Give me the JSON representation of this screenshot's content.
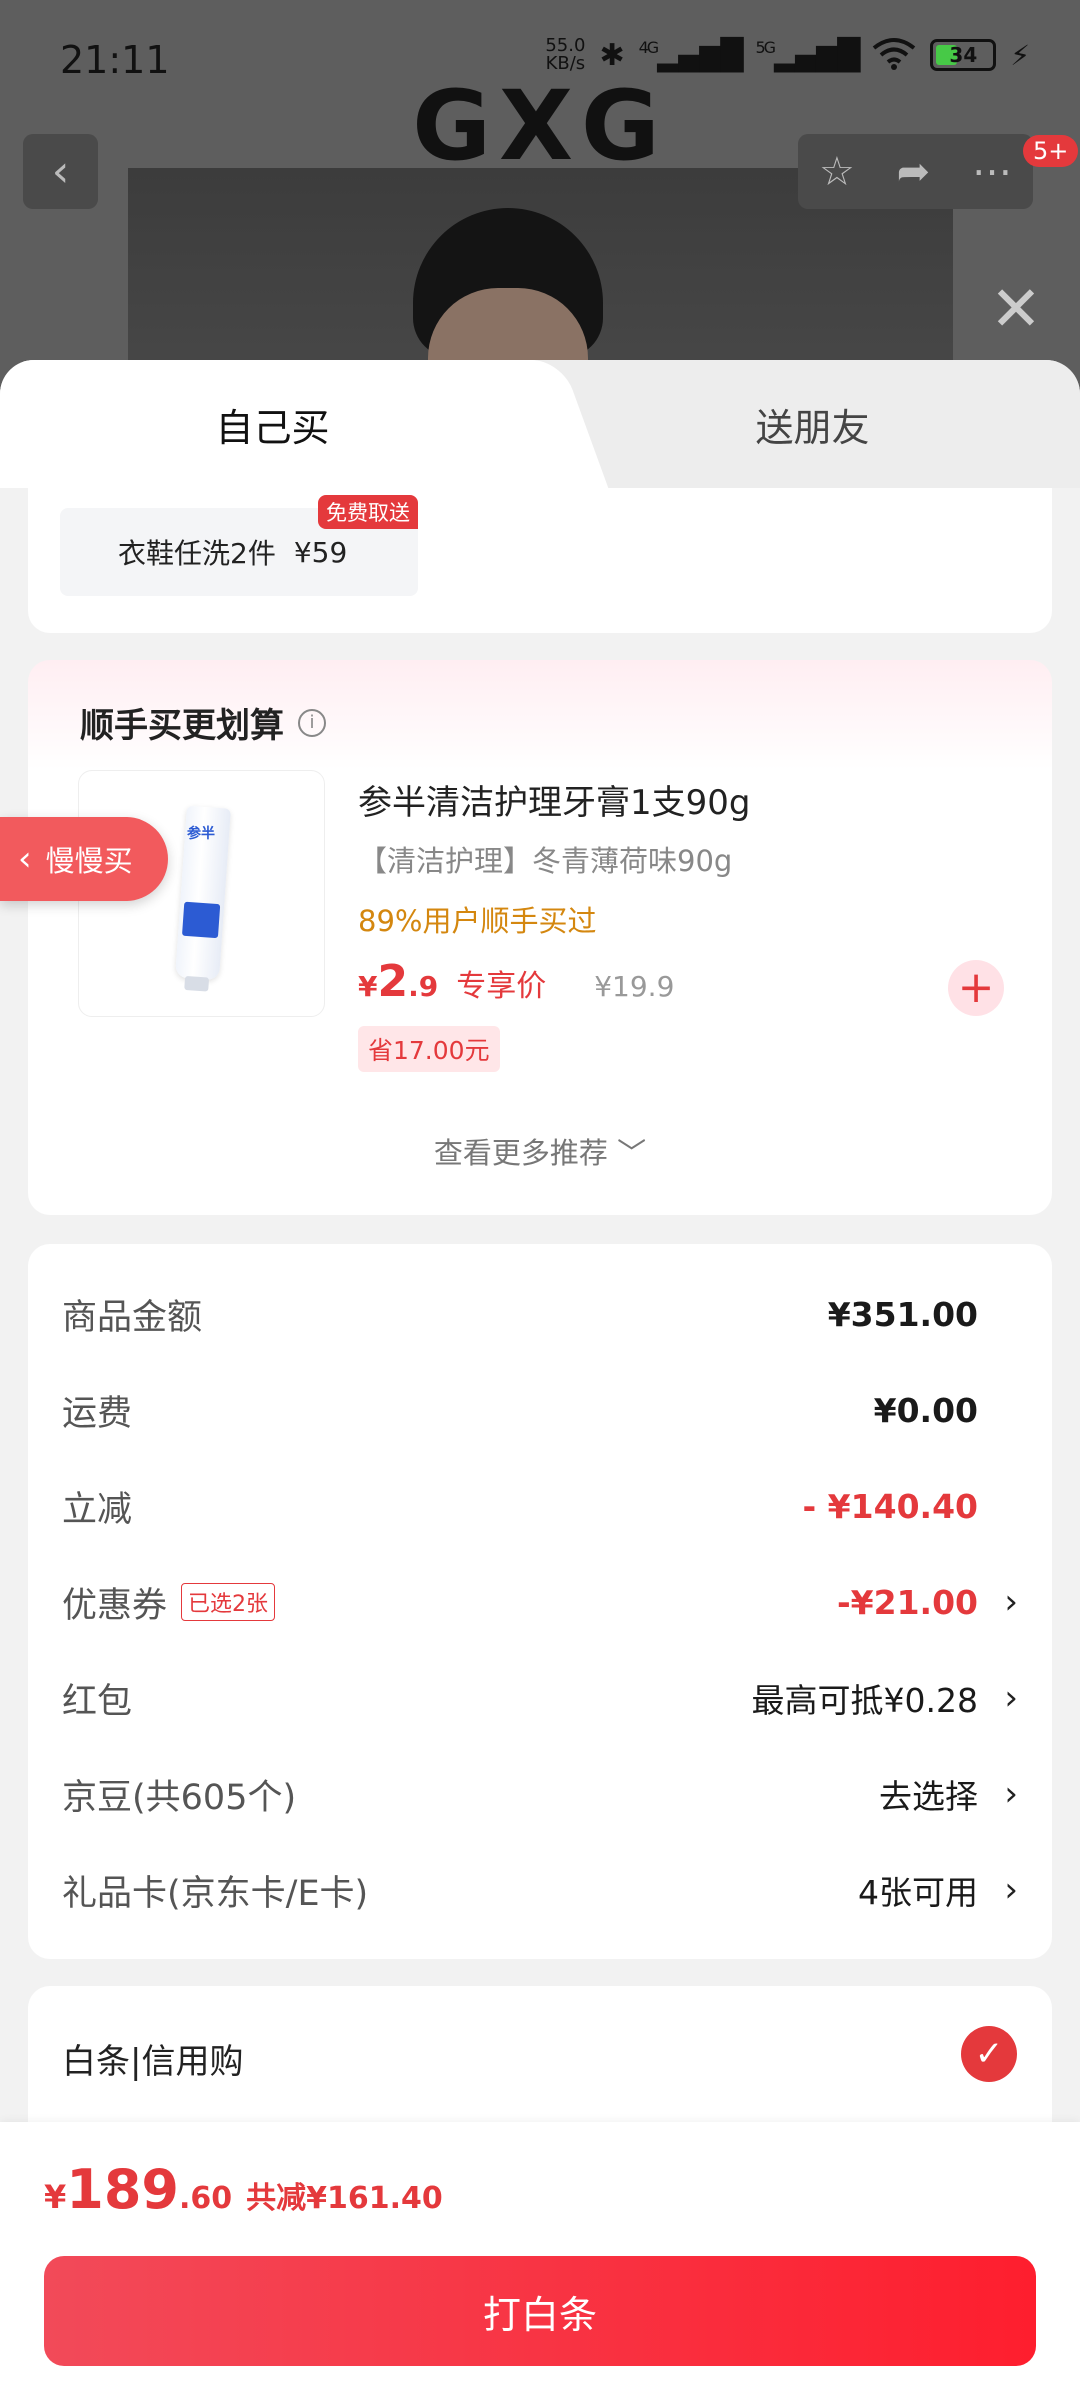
{
  "status_bar": {
    "time": "21:11",
    "net_speed_value": "55.0",
    "net_speed_unit": "KB/s",
    "signal_1": "4G",
    "signal_2": "5G",
    "battery": "34"
  },
  "background_page": {
    "brand_logo": "GXG",
    "cart_badge": "5+"
  },
  "tabs": {
    "buy_self": "自己买",
    "gift_friend": "送朋友"
  },
  "service": {
    "name": "衣鞋任洗2件",
    "price": "¥59",
    "tag": "免费取送"
  },
  "upsell": {
    "title": "顺手买更划算",
    "product": {
      "name": "参半清洁护理牙膏1支90g",
      "spec": "【清洁护理】冬青薄荷味90g",
      "social_proof": "89%用户顺手买过",
      "price_currency": "¥",
      "price_int": "2",
      "price_dec": ".9",
      "price_label": "专享价",
      "original_price": "¥19.9",
      "save": "省17.00元",
      "thumb_brand": "参半"
    },
    "more": "查看更多推荐 ﹀"
  },
  "float_button": {
    "label": "慢慢买"
  },
  "summary": {
    "rows": [
      {
        "label": "商品金额",
        "value": "¥351.00"
      },
      {
        "label": "运费",
        "value": "¥0.00"
      },
      {
        "label": "立减",
        "value": "- ¥140.40"
      },
      {
        "label": "优惠券",
        "tag": "已选2张",
        "value": "-¥21.00"
      },
      {
        "label": "红包",
        "value": "最高可抵¥0.28"
      },
      {
        "label": "京豆(共605个)",
        "value": "去选择"
      },
      {
        "label": "礼品卡(京东卡/E卡)",
        "value": "4张可用"
      }
    ]
  },
  "payment": {
    "method": "白条|信用购"
  },
  "bottom": {
    "currency": "¥",
    "total_int": "189",
    "total_dec": ".60",
    "discount": "共减¥161.40",
    "pay_button": "打白条"
  },
  "colors": {
    "accent": "#e4393c",
    "social_proof": "#d4870f"
  }
}
